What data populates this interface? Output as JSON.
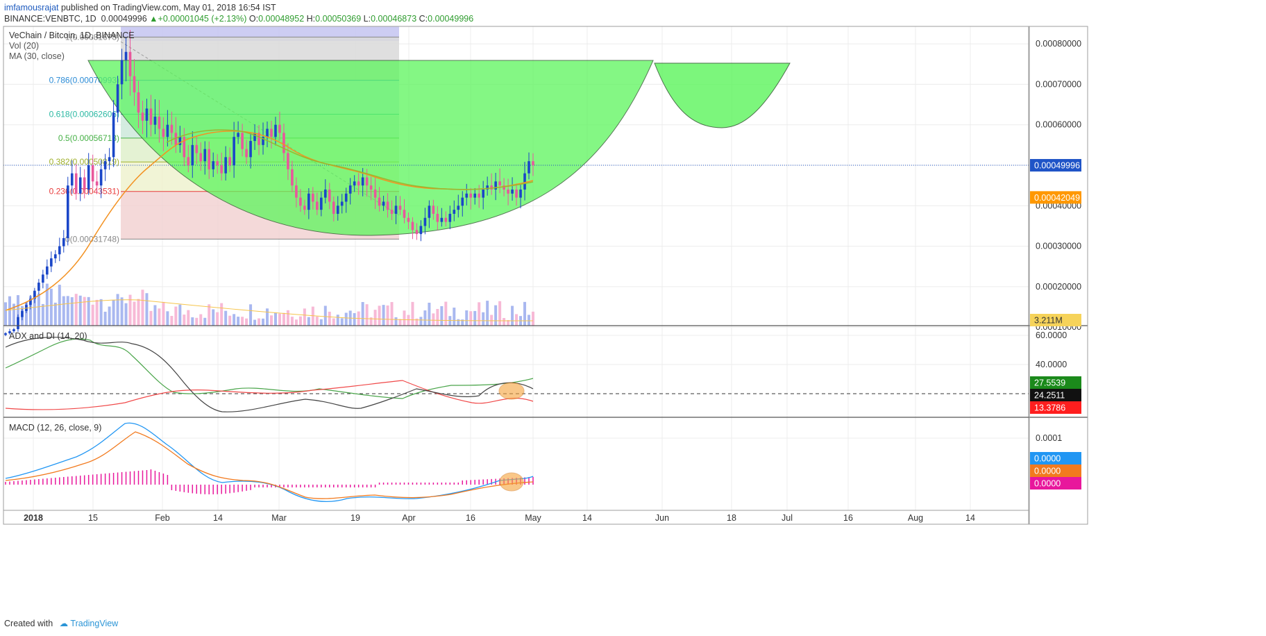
{
  "header": {
    "author": "imfamousrajat",
    "published_text": "published on TradingView.com, May 01, 2018 16:54 IST",
    "symbol": "BINANCE:VENBTC, 1D",
    "last": "0.00049996",
    "change_arrow": "▲",
    "change": "+0.00001045 (+2.13%)",
    "open_label": "O:",
    "open": "0.00048952",
    "high_label": "H:",
    "high": "0.00050369",
    "low_label": "L:",
    "low": "0.00046873",
    "close_label": "C:",
    "close": "0.00049996"
  },
  "footer": {
    "created_with": "Created with",
    "brand": "TradingView"
  },
  "colors": {
    "up_candle": "#1a46c8",
    "down_candle": "#e8579c",
    "ma": "#f39222",
    "ma30": "#9bb62e",
    "cup_fill": "#5cf55c",
    "plus_di": "#4aa54a",
    "minus_di": "#f04848",
    "adx": "#444444",
    "macd": "#2196f3",
    "signal": "#f27a1e",
    "histogram": "#e8179c",
    "last_price_badge": "#1f54c7",
    "ma_badge": "#ff9800"
  },
  "chart_data": [
    {
      "type": "candlestick",
      "pane": "price",
      "title": "VeChain / Bitcoin, 1D, BINANCE",
      "indicators_legend": [
        "Vol (20)",
        "MA (30, close)"
      ],
      "x_ticks": [
        "2018",
        "15",
        "Feb",
        "14",
        "Mar",
        "19",
        "Apr",
        "16",
        "May",
        "14",
        "Jun",
        "18",
        "Jul",
        "16",
        "Aug",
        "14"
      ],
      "y_ticks": [
        "0.00080000",
        "0.00070000",
        "0.00060000",
        "0.00050000",
        "0.00040000",
        "0.00030000",
        "0.00020000",
        "0.00010000"
      ],
      "y_range": [
        0.0,
        0.00082
      ],
      "last_price_label": "0.00049996",
      "ma_value_label": "0.00042049",
      "volume_label": "3.211M",
      "fib_levels": [
        {
          "ratio": "1",
          "price": "0.00081678",
          "label": "1(0.00081678)",
          "color": "#888888"
        },
        {
          "ratio": "0.786",
          "price": "0.00070993",
          "label": "0.786(0.00070993)",
          "color": "#2a8bd6"
        },
        {
          "ratio": "0.618",
          "price": "0.00062606",
          "label": "0.618(0.00062606)",
          "color": "#2ab8a2"
        },
        {
          "ratio": "0.5",
          "price": "0.00056713",
          "label": "0.5(0.00056713)",
          "color": "#45b045"
        },
        {
          "ratio": "0.382",
          "price": "0.00050819",
          "label": "0.382(0.00050819)",
          "color": "#9fb02a"
        },
        {
          "ratio": "0.236",
          "price": "0.00043531",
          "label": "0.236(0.00043531)",
          "color": "#e83a3a"
        },
        {
          "ratio": "0",
          "price": "0.00031748",
          "label": "0(0.00031748)",
          "color": "#888888"
        }
      ],
      "pattern": "cup and handle",
      "closes": [
        8.5e-05,
        9e-05,
        9.5e-05,
        0.000125,
        0.00014,
        0.000155,
        0.00017,
        0.00019,
        0.00021,
        0.00023,
        0.00025,
        0.00027,
        0.00028,
        0.0003,
        0.00032,
        0.00045,
        0.00048,
        0.00043,
        0.00047,
        0.00044,
        0.0005,
        0.00046,
        0.00045,
        0.00049,
        0.00051,
        0.00052,
        0.00063,
        0.0007,
        0.00076,
        0.00078,
        0.00072,
        0.00068,
        0.00063,
        0.00061,
        0.00064,
        0.0006,
        0.00062,
        0.00059,
        0.00057,
        0.0006,
        0.00058,
        0.00055,
        0.00057,
        0.00052,
        0.0005,
        0.00055,
        0.00053,
        0.00051,
        0.00054,
        0.00049,
        0.00051,
        0.0005,
        0.00048,
        0.00052,
        0.0005,
        0.00057,
        0.00058,
        0.00054,
        0.00052,
        0.00056,
        0.00058,
        0.00055,
        0.00057,
        0.00059,
        0.00057,
        0.0006,
        0.00058,
        0.00053,
        0.00049,
        0.00045,
        0.00042,
        0.0004,
        0.00039,
        0.00043,
        0.00041,
        0.00039,
        0.00042,
        0.00044,
        0.00041,
        0.00038,
        0.0004,
        0.00041,
        0.00043,
        0.00045,
        0.00046,
        0.00045,
        0.00047,
        0.00045,
        0.00044,
        0.00042,
        0.0004,
        0.00041,
        0.00039,
        0.00038,
        0.0004,
        0.00039,
        0.00037,
        0.00036,
        0.00034,
        0.00033,
        0.00035,
        0.00037,
        0.0004,
        0.00038,
        0.00036,
        0.00037,
        0.00036,
        0.00038,
        0.00039,
        0.0004,
        0.00042,
        0.00043,
        0.00042,
        0.00043,
        0.00042,
        0.00044,
        0.00045,
        0.00044,
        0.00046,
        0.00045,
        0.00044,
        0.00043,
        0.00044,
        0.00042,
        0.00044,
        0.00048,
        0.00051,
        0.00049996
      ]
    },
    {
      "type": "line",
      "pane": "ADX",
      "title": "ADX and DI (14, 20)",
      "y_ticks": [
        "60.0000",
        "40.0000"
      ],
      "series": [
        {
          "name": "+DI",
          "last": "27.5539"
        },
        {
          "name": "ADX",
          "last": "24.2511"
        },
        {
          "name": "-DI",
          "last": "13.3786"
        }
      ],
      "threshold": 20
    },
    {
      "type": "line",
      "pane": "MACD",
      "title": "MACD (12, 26, close, 9)",
      "y_ticks": [
        "0.0001"
      ],
      "series": [
        {
          "name": "MACD",
          "last": "0.0000"
        },
        {
          "name": "Signal",
          "last": "0.0000"
        },
        {
          "name": "Histogram",
          "last": "0.0000"
        }
      ]
    }
  ]
}
